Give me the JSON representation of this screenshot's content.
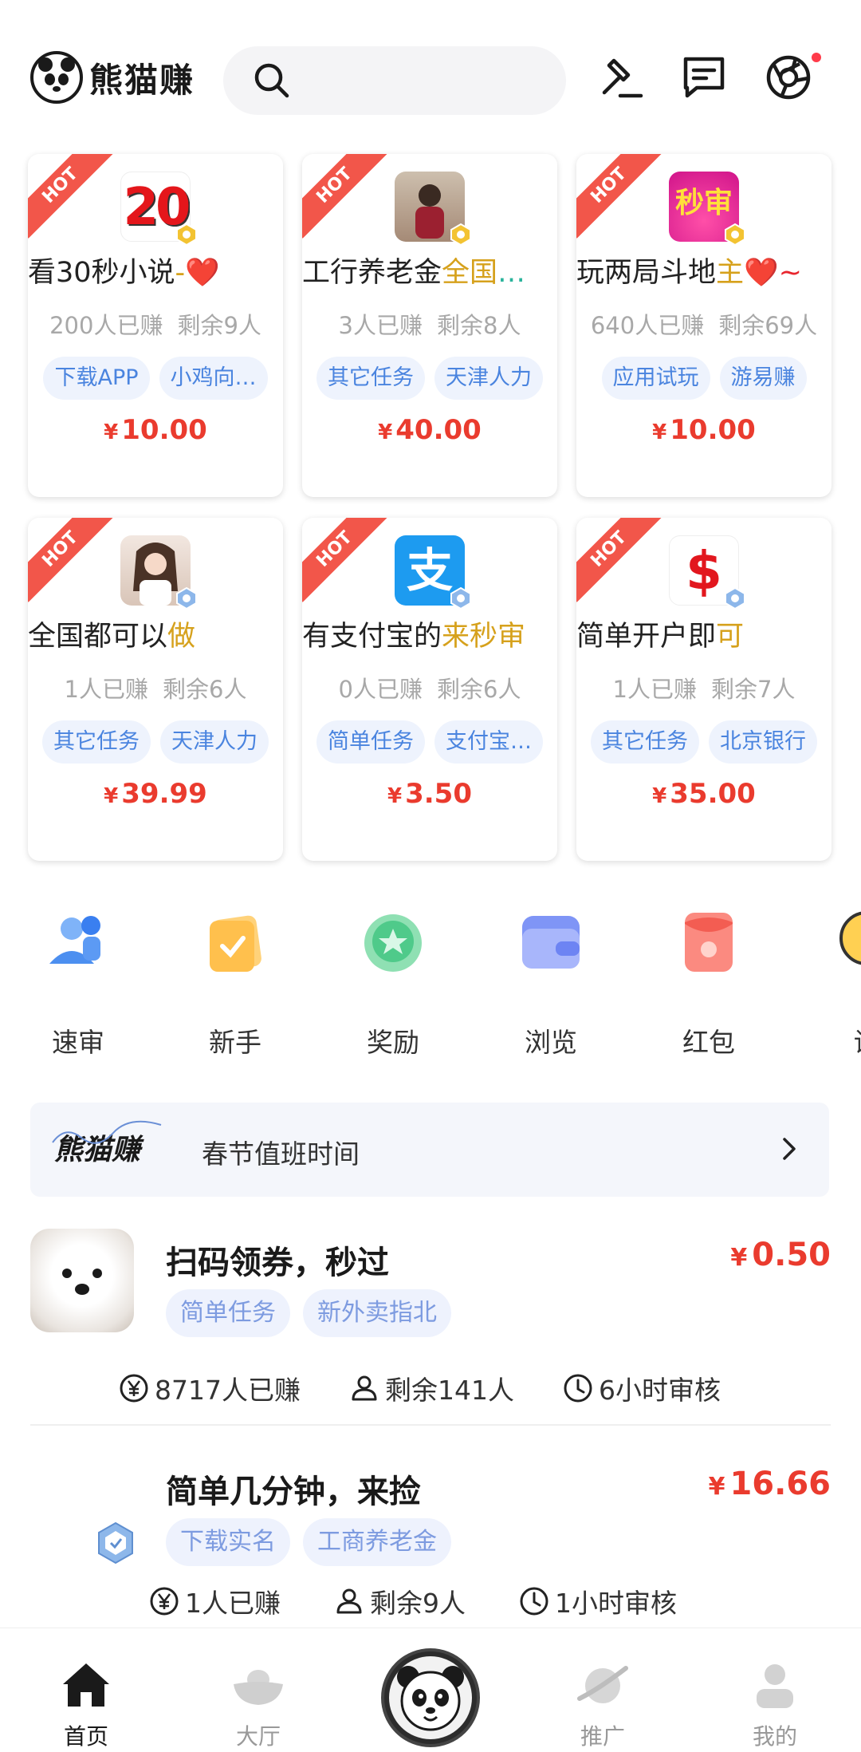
{
  "header": {
    "logo_text": "熊猫赚",
    "search_placeholder": ""
  },
  "tasks": [
    {
      "ribbon": "HOT",
      "avatar_text": "20",
      "title_parts": [
        "看30秒小说",
        "-",
        "❤️"
      ],
      "earned": "200人已赚",
      "remaining": "剩余9人",
      "tags": [
        "下载APP",
        "小鸡向…"
      ],
      "yen": "¥",
      "price": "10.00"
    },
    {
      "ribbon": "HOT",
      "avatar_text": "",
      "title_parts": [
        "工行养老金",
        "全国",
        "…"
      ],
      "earned": "3人已赚",
      "remaining": "剩余8人",
      "tags": [
        "其它任务",
        "天津人力"
      ],
      "yen": "¥",
      "price": "40.00"
    },
    {
      "ribbon": "HOT",
      "avatar_text": "秒审",
      "title_parts": [
        "玩两局斗地",
        "主",
        "❤️~"
      ],
      "earned": "640人已赚",
      "remaining": "剩余69人",
      "tags": [
        "应用试玩",
        "游易赚"
      ],
      "yen": "¥",
      "price": "10.00"
    },
    {
      "ribbon": "HOT",
      "avatar_text": "",
      "title_parts": [
        "全国都可以",
        "做",
        ""
      ],
      "earned": "1人已赚",
      "remaining": "剩余6人",
      "tags": [
        "其它任务",
        "天津人力"
      ],
      "yen": "¥",
      "price": "39.99"
    },
    {
      "ribbon": "HOT",
      "avatar_text": "支",
      "title_parts": [
        "有支付宝的",
        "来秒审",
        ""
      ],
      "earned": "0人已赚",
      "remaining": "剩余6人",
      "tags": [
        "简单任务",
        "支付宝…"
      ],
      "yen": "¥",
      "price": "3.50"
    },
    {
      "ribbon": "HOT",
      "avatar_text": "$",
      "title_parts": [
        "简单开户即",
        "可",
        ""
      ],
      "earned": "1人已赚",
      "remaining": "剩余7人",
      "tags": [
        "其它任务",
        "北京银行"
      ],
      "yen": "¥",
      "price": "35.00"
    }
  ],
  "categories": [
    {
      "label": "速审",
      "icon": "fast-review-icon"
    },
    {
      "label": "新手",
      "icon": "newbie-icon"
    },
    {
      "label": "奖励",
      "icon": "reward-icon"
    },
    {
      "label": "浏览",
      "icon": "browse-icon"
    },
    {
      "label": "红包",
      "icon": "red-packet-icon"
    },
    {
      "label": "试",
      "icon": "trial-icon"
    }
  ],
  "notice": {
    "logo_text": "熊猫赚",
    "text": "春节值班时间"
  },
  "list": [
    {
      "title": "扫码领券，秒过",
      "yen": "¥",
      "price": "0.50",
      "tags": [
        "简单任务",
        "新外卖指北"
      ],
      "earned": "8717人已赚",
      "remaining": "剩余141人",
      "review": "6小时审核"
    },
    {
      "title": "简单几分钟，来捡",
      "yen": "¥",
      "price": "16.66",
      "tags": [
        "下载实名",
        "工商养老金"
      ],
      "earned": "1人已赚",
      "remaining": "剩余9人",
      "review": "1小时审核"
    }
  ],
  "nav": {
    "home": "首页",
    "hall": "大厅",
    "promote": "推广",
    "mine": "我的"
  },
  "colors": {
    "price_red": "#ea3b2e",
    "tag_blue": "#4a84df",
    "hot_red": "#f2564a"
  }
}
